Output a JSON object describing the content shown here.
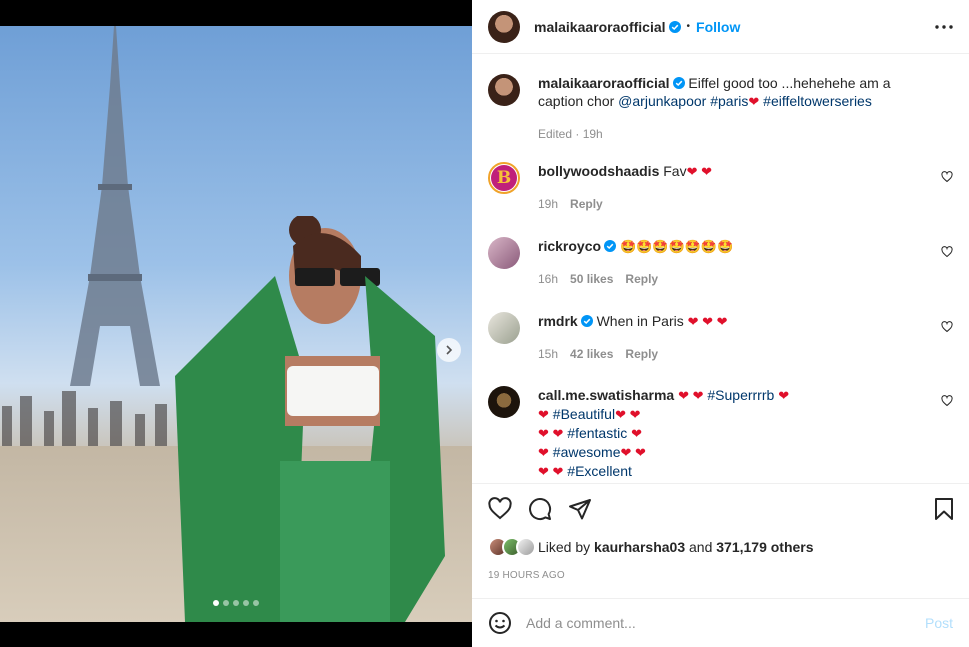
{
  "post": {
    "author": "malaikaaroraofficial",
    "dot_separator": "•",
    "follow_label": "Follow",
    "caption_text": "Eiffel good too ...hehehehe am a caption chor",
    "caption_mention": "@arjunkapoor",
    "caption_tag1": "#paris",
    "caption_tag2": "#eiffeltowerseries",
    "caption_meta": "Edited · 19h"
  },
  "comments": [
    {
      "user": "bollywoodshaadis",
      "text": "Fav",
      "time": "19h",
      "reply": "Reply"
    },
    {
      "user": "rickroyco",
      "emoji": "🤩🤩🤩🤩🤩🤩🤩",
      "time": "16h",
      "likes": "50 likes",
      "reply": "Reply"
    },
    {
      "user": "rmdrk",
      "text": "When in Paris",
      "time": "15h",
      "likes": "42 likes",
      "reply": "Reply"
    },
    {
      "user": "call.me.swatisharma",
      "tag1": "#Superrrrb",
      "tag2": "#Beautiful",
      "tag3": "#fentastic",
      "tag4": "#awesome",
      "tag5": "#Excellent"
    }
  ],
  "likes": {
    "prefix": "Liked by",
    "user": "kaurharsha03",
    "and": "and",
    "count": "371,179 others"
  },
  "timestamp": "19 HOURS AGO",
  "add_comment": {
    "placeholder": "Add a comment...",
    "post_label": "Post"
  },
  "colors": {
    "accent": "#0095f6",
    "heart": "#e0102b",
    "muted": "#8e8e8e",
    "link": "#00376b"
  },
  "carousel": {
    "slides": 5,
    "active": 1
  }
}
